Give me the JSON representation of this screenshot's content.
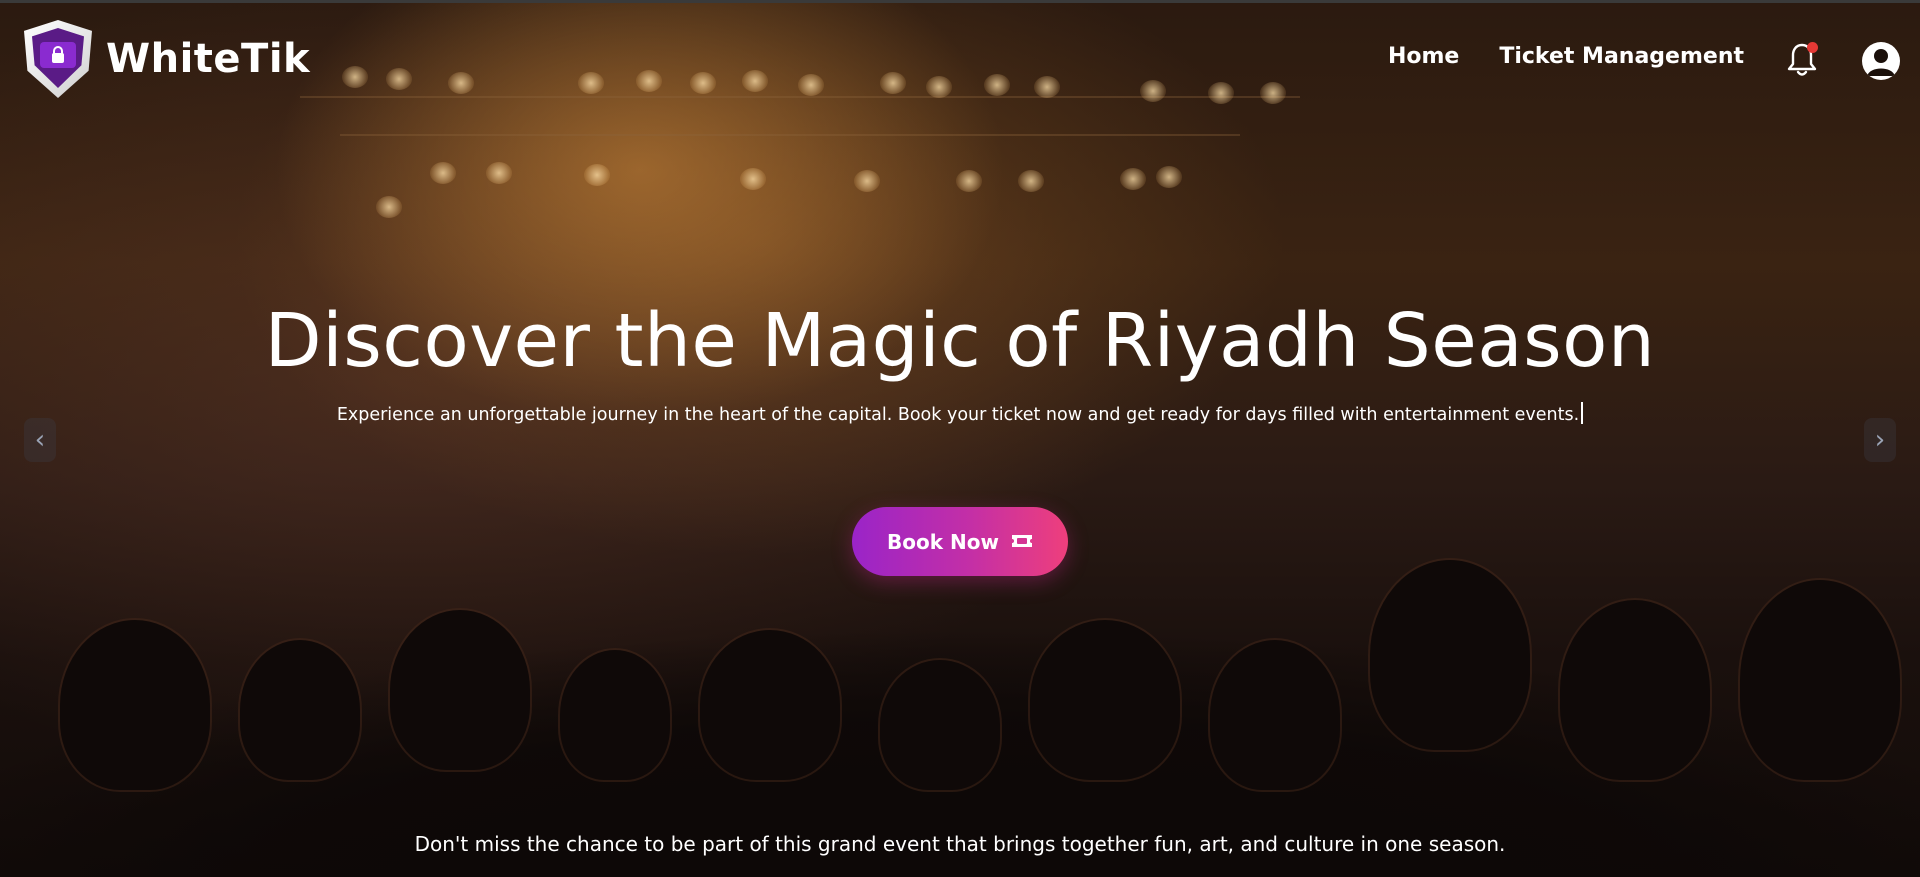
{
  "brand": {
    "name": "WhiteTik",
    "icon": "shield-ticket-lock-logo"
  },
  "nav": {
    "links": [
      {
        "label": "Home"
      },
      {
        "label": "Ticket Management"
      }
    ],
    "notification_icon": "bell-icon",
    "has_unread_notification": true,
    "profile_icon": "user-circle-icon"
  },
  "hero": {
    "title": "Discover the Magic of Riyadh Season",
    "subtitle": "Experience an unforgettable journey in the heart of the capital. Book your ticket now and get ready for days filled with entertainment events.",
    "cta": {
      "label": "Book Now",
      "icon": "ticket-icon"
    },
    "carousel": {
      "prev_glyph": "‹",
      "next_glyph": "›"
    },
    "footer_text": "Don't miss the chance to be part of this grand event that brings together fun, art, and culture in one season."
  },
  "colors": {
    "cta_gradient_start": "#9a24c8",
    "cta_gradient_end": "#ee3f7c",
    "brand_purple": "#5a1b86",
    "notification_dot": "#e53935",
    "text": "#ffffff"
  }
}
